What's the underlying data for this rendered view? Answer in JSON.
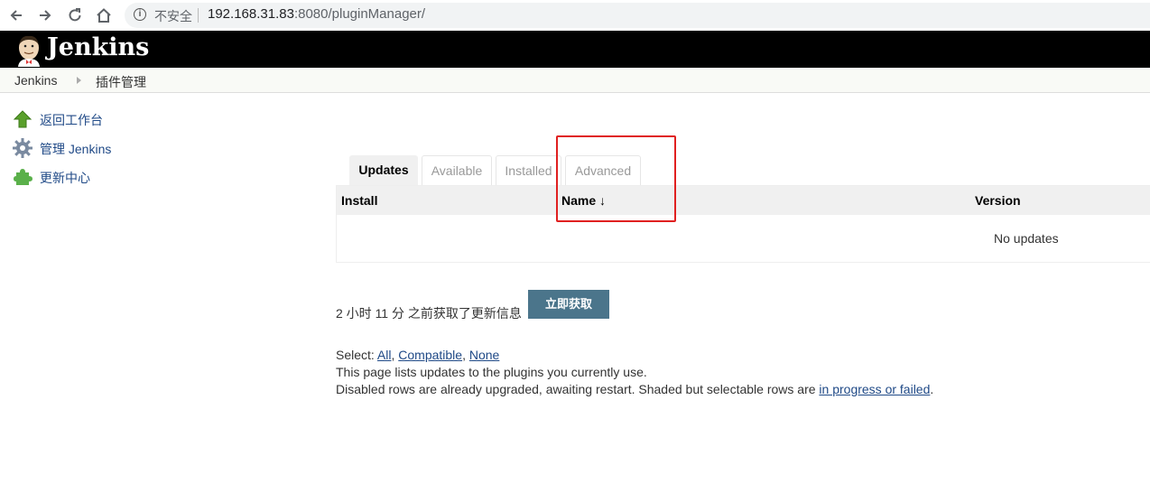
{
  "browser": {
    "security_label": "不安全",
    "url_host": "192.168.31.83",
    "url_rest": ":8080/pluginManager/"
  },
  "header": {
    "logo_text": "Jenkins"
  },
  "breadcrumb": {
    "items": [
      "Jenkins",
      "插件管理"
    ]
  },
  "sidebar": {
    "items": [
      {
        "label": "返回工作台",
        "icon": "up-arrow-icon"
      },
      {
        "label": "管理 Jenkins",
        "icon": "gear-icon"
      },
      {
        "label": "更新中心",
        "icon": "puzzle-icon"
      }
    ]
  },
  "tabs": [
    {
      "label": "Updates",
      "active": true
    },
    {
      "label": "Available",
      "active": false
    },
    {
      "label": "Installed",
      "active": false
    },
    {
      "label": "Advanced",
      "active": false
    }
  ],
  "table": {
    "columns": [
      "Install",
      "Name",
      "Version"
    ],
    "sort_indicator": "↓",
    "empty_message": "No updates"
  },
  "update_info": {
    "text": "2 小时 11 分 之前获取了更新信息",
    "button_label": "立即获取"
  },
  "footer": {
    "select_prefix": "Select: ",
    "select_all": "All",
    "select_compatible": "Compatible",
    "select_none": "None",
    "line2": "This page lists updates to the plugins you currently use.",
    "line3_prefix": "Disabled rows are already upgraded, awaiting restart. Shaded but selectable rows are ",
    "line3_link": "in progress or failed",
    "line3_suffix": "."
  },
  "colors": {
    "header_bg": "#000000",
    "button_bg": "#4b758b",
    "link": "#204a87",
    "highlight": "#e02020"
  }
}
